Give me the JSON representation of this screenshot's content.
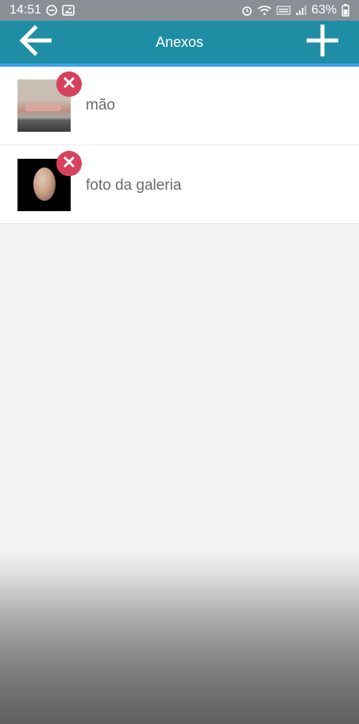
{
  "status_bar": {
    "time": "14:51",
    "battery": "63%"
  },
  "header": {
    "title": "Anexos",
    "back_icon": "arrow-left-icon",
    "add_icon": "plus-icon"
  },
  "attachments": [
    {
      "label": "mão",
      "thumb_icon": "photo-hand-thumbnail",
      "remove_icon": "close-icon"
    },
    {
      "label": "foto da galeria",
      "thumb_icon": "photo-moon-thumbnail",
      "remove_icon": "close-icon"
    }
  ],
  "colors": {
    "appbar": "#1f8ea5",
    "accent": "#3aa1f0",
    "remove": "#d6425d",
    "background": "#f2f3f5"
  }
}
